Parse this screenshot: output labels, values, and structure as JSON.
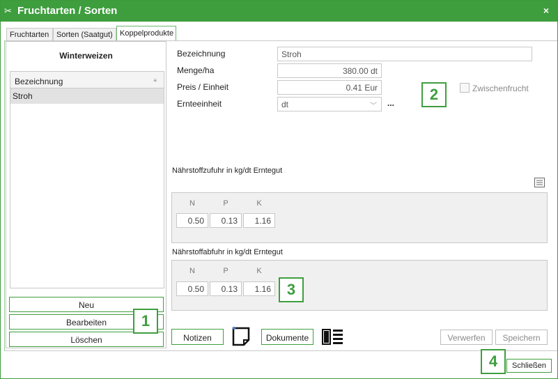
{
  "window": {
    "title": "Fruchtarten / Sorten",
    "close_glyph": "×"
  },
  "tabs": [
    {
      "label": "Fruchtarten"
    },
    {
      "label": "Sorten (Saatgut)"
    },
    {
      "label": "Koppelprodukte"
    }
  ],
  "left": {
    "crop_name": "Winterweizen",
    "grid_header": "Bezeichnung",
    "rows": [
      {
        "label": "Stroh"
      }
    ],
    "buttons": {
      "new": "Neu",
      "edit": "Bearbeiten",
      "delete": "Löschen"
    }
  },
  "form": {
    "bezeichnung_label": "Bezeichnung",
    "bezeichnung_value": "Stroh",
    "menge_label": "Menge/ha",
    "menge_value": "380.00 dt",
    "preis_label": "Preis / Einheit",
    "preis_value": "0.41 Eur",
    "ernte_label": "Ernteeinheit",
    "ernte_value": "dt",
    "more_glyph": "...",
    "zwischenfrucht_label": "Zwischenfrucht"
  },
  "zufuhr": {
    "title": "Nährstoffzufuhr in kg/dt Erntegut",
    "headers": [
      "N",
      "P",
      "K"
    ],
    "values": [
      "0.50",
      "0.13",
      "1.16"
    ]
  },
  "abfuhr": {
    "title": "Nährstoffabfuhr in kg/dt Erntegut",
    "headers": [
      "N",
      "P",
      "K"
    ],
    "values": [
      "0.50",
      "0.13",
      "1.16"
    ]
  },
  "bottom": {
    "notes": "Notizen",
    "documents": "Dokumente",
    "discard": "Verwerfen",
    "save": "Speichern",
    "close": "Schließen"
  },
  "badges": [
    "1",
    "2",
    "3",
    "4"
  ],
  "colors": {
    "accent": "#3e9e3e",
    "panel": "#f0f0f0"
  }
}
